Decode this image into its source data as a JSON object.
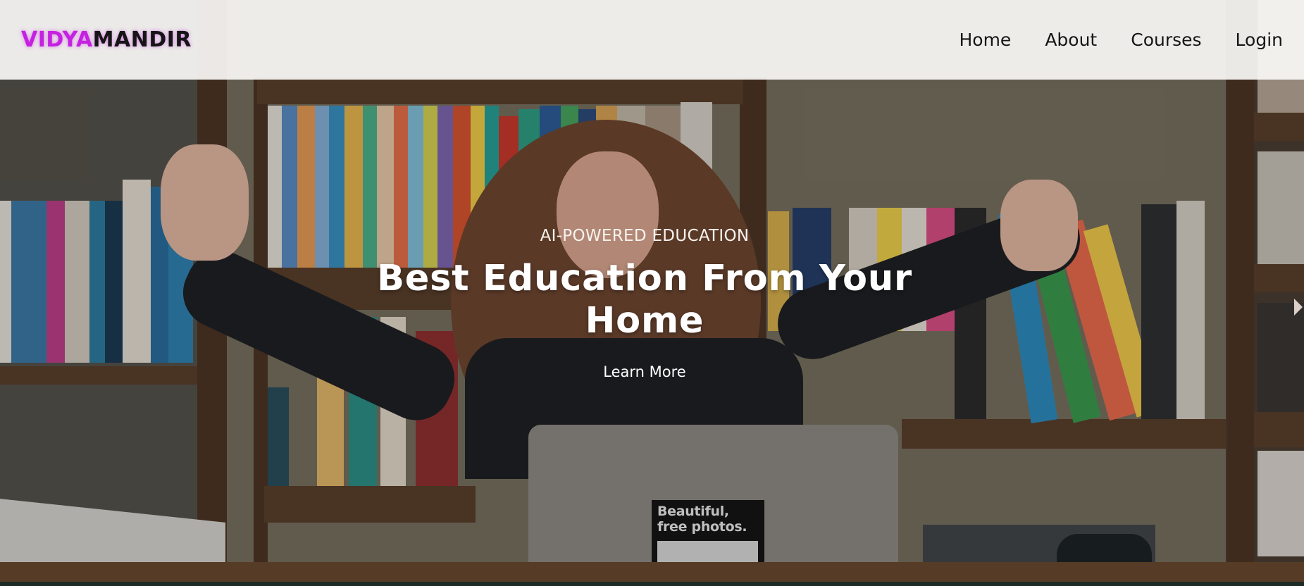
{
  "brand": {
    "logo_part1": "VIDYA",
    "logo_part2": "MANDIR",
    "accent_color": "#c421e0"
  },
  "nav": {
    "items": [
      {
        "label": "Home"
      },
      {
        "label": "About"
      },
      {
        "label": "Courses"
      },
      {
        "label": "Login"
      }
    ]
  },
  "hero": {
    "eyebrow": "AI-POWERED EDUCATION",
    "headline_line1": "Best Education From Your",
    "headline_line2": "Home",
    "cta_label": "Learn More",
    "sticker_line1": "Beautiful,",
    "sticker_line2": "free photos."
  },
  "icons": {
    "carousel_next": "chevron-right-icon"
  }
}
